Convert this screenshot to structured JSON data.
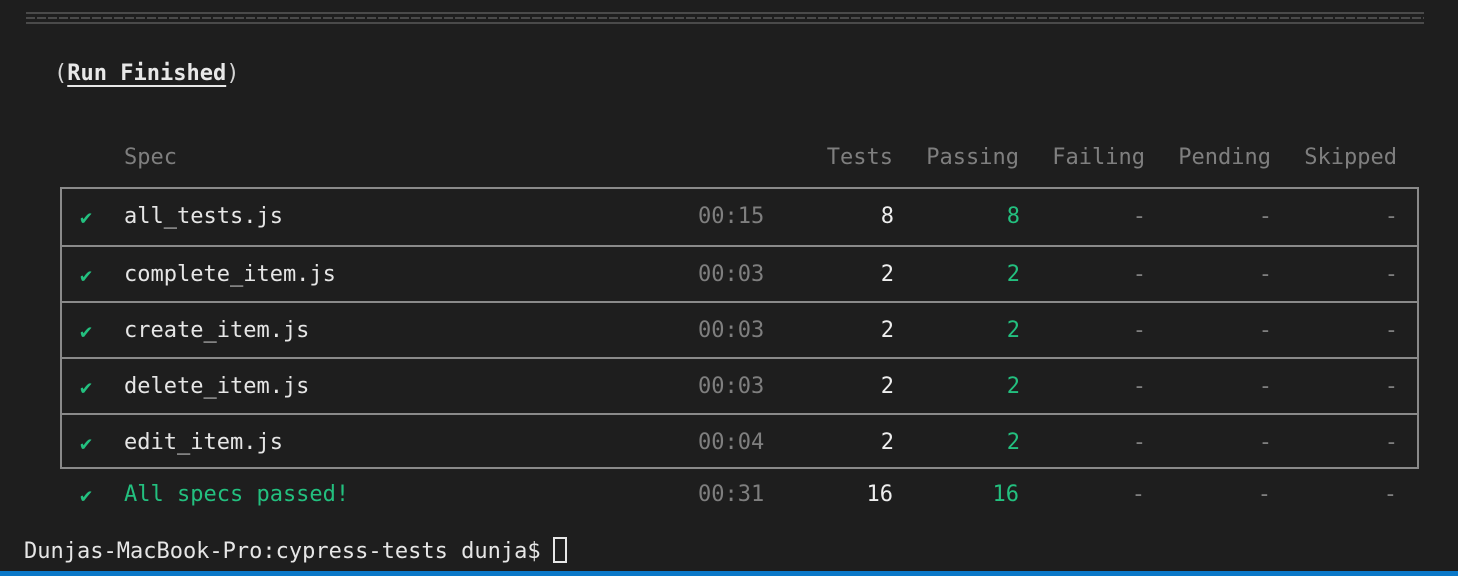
{
  "run": {
    "open_paren": "(",
    "label": "Run Finished",
    "close_paren": ")"
  },
  "headers": {
    "spec": "Spec",
    "tests": "Tests",
    "passing": "Passing",
    "failing": "Failing",
    "pending": "Pending",
    "skipped": "Skipped"
  },
  "rows": [
    {
      "status": "✔",
      "spec": "all_tests.js",
      "duration": "00:15",
      "tests": "8",
      "passing": "8",
      "failing": "-",
      "pending": "-",
      "skipped": "-"
    },
    {
      "status": "✔",
      "spec": "complete_item.js",
      "duration": "00:03",
      "tests": "2",
      "passing": "2",
      "failing": "-",
      "pending": "-",
      "skipped": "-"
    },
    {
      "status": "✔",
      "spec": "create_item.js",
      "duration": "00:03",
      "tests": "2",
      "passing": "2",
      "failing": "-",
      "pending": "-",
      "skipped": "-"
    },
    {
      "status": "✔",
      "spec": "delete_item.js",
      "duration": "00:03",
      "tests": "2",
      "passing": "2",
      "failing": "-",
      "pending": "-",
      "skipped": "-"
    },
    {
      "status": "✔",
      "spec": "edit_item.js",
      "duration": "00:04",
      "tests": "2",
      "passing": "2",
      "failing": "-",
      "pending": "-",
      "skipped": "-"
    }
  ],
  "summary": {
    "status": "✔",
    "message": "All specs passed!",
    "duration": "00:31",
    "tests": "16",
    "passing": "16",
    "failing": "-",
    "pending": "-",
    "skipped": "-"
  },
  "prompt": {
    "text": "Dunjas-MacBook-Pro:cypress-tests dunja$"
  },
  "colors": {
    "background": "#1e1e1e",
    "success": "#23c07f",
    "muted": "#7f7f7f",
    "border": "#8a8a8a",
    "status_bar": "#0a78c8"
  }
}
